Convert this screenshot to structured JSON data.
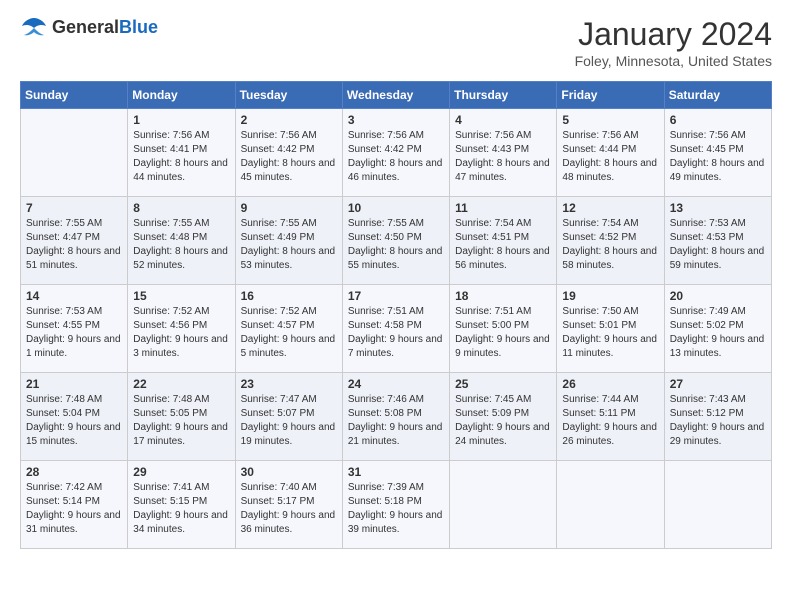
{
  "header": {
    "logo_general": "General",
    "logo_blue": "Blue",
    "month": "January 2024",
    "location": "Foley, Minnesota, United States"
  },
  "days_of_week": [
    "Sunday",
    "Monday",
    "Tuesday",
    "Wednesday",
    "Thursday",
    "Friday",
    "Saturday"
  ],
  "weeks": [
    [
      {
        "day": "",
        "sunrise": "",
        "sunset": "",
        "daylight": ""
      },
      {
        "day": "1",
        "sunrise": "Sunrise: 7:56 AM",
        "sunset": "Sunset: 4:41 PM",
        "daylight": "Daylight: 8 hours and 44 minutes."
      },
      {
        "day": "2",
        "sunrise": "Sunrise: 7:56 AM",
        "sunset": "Sunset: 4:42 PM",
        "daylight": "Daylight: 8 hours and 45 minutes."
      },
      {
        "day": "3",
        "sunrise": "Sunrise: 7:56 AM",
        "sunset": "Sunset: 4:42 PM",
        "daylight": "Daylight: 8 hours and 46 minutes."
      },
      {
        "day": "4",
        "sunrise": "Sunrise: 7:56 AM",
        "sunset": "Sunset: 4:43 PM",
        "daylight": "Daylight: 8 hours and 47 minutes."
      },
      {
        "day": "5",
        "sunrise": "Sunrise: 7:56 AM",
        "sunset": "Sunset: 4:44 PM",
        "daylight": "Daylight: 8 hours and 48 minutes."
      },
      {
        "day": "6",
        "sunrise": "Sunrise: 7:56 AM",
        "sunset": "Sunset: 4:45 PM",
        "daylight": "Daylight: 8 hours and 49 minutes."
      }
    ],
    [
      {
        "day": "7",
        "sunrise": "Sunrise: 7:55 AM",
        "sunset": "Sunset: 4:47 PM",
        "daylight": "Daylight: 8 hours and 51 minutes."
      },
      {
        "day": "8",
        "sunrise": "Sunrise: 7:55 AM",
        "sunset": "Sunset: 4:48 PM",
        "daylight": "Daylight: 8 hours and 52 minutes."
      },
      {
        "day": "9",
        "sunrise": "Sunrise: 7:55 AM",
        "sunset": "Sunset: 4:49 PM",
        "daylight": "Daylight: 8 hours and 53 minutes."
      },
      {
        "day": "10",
        "sunrise": "Sunrise: 7:55 AM",
        "sunset": "Sunset: 4:50 PM",
        "daylight": "Daylight: 8 hours and 55 minutes."
      },
      {
        "day": "11",
        "sunrise": "Sunrise: 7:54 AM",
        "sunset": "Sunset: 4:51 PM",
        "daylight": "Daylight: 8 hours and 56 minutes."
      },
      {
        "day": "12",
        "sunrise": "Sunrise: 7:54 AM",
        "sunset": "Sunset: 4:52 PM",
        "daylight": "Daylight: 8 hours and 58 minutes."
      },
      {
        "day": "13",
        "sunrise": "Sunrise: 7:53 AM",
        "sunset": "Sunset: 4:53 PM",
        "daylight": "Daylight: 8 hours and 59 minutes."
      }
    ],
    [
      {
        "day": "14",
        "sunrise": "Sunrise: 7:53 AM",
        "sunset": "Sunset: 4:55 PM",
        "daylight": "Daylight: 9 hours and 1 minute."
      },
      {
        "day": "15",
        "sunrise": "Sunrise: 7:52 AM",
        "sunset": "Sunset: 4:56 PM",
        "daylight": "Daylight: 9 hours and 3 minutes."
      },
      {
        "day": "16",
        "sunrise": "Sunrise: 7:52 AM",
        "sunset": "Sunset: 4:57 PM",
        "daylight": "Daylight: 9 hours and 5 minutes."
      },
      {
        "day": "17",
        "sunrise": "Sunrise: 7:51 AM",
        "sunset": "Sunset: 4:58 PM",
        "daylight": "Daylight: 9 hours and 7 minutes."
      },
      {
        "day": "18",
        "sunrise": "Sunrise: 7:51 AM",
        "sunset": "Sunset: 5:00 PM",
        "daylight": "Daylight: 9 hours and 9 minutes."
      },
      {
        "day": "19",
        "sunrise": "Sunrise: 7:50 AM",
        "sunset": "Sunset: 5:01 PM",
        "daylight": "Daylight: 9 hours and 11 minutes."
      },
      {
        "day": "20",
        "sunrise": "Sunrise: 7:49 AM",
        "sunset": "Sunset: 5:02 PM",
        "daylight": "Daylight: 9 hours and 13 minutes."
      }
    ],
    [
      {
        "day": "21",
        "sunrise": "Sunrise: 7:48 AM",
        "sunset": "Sunset: 5:04 PM",
        "daylight": "Daylight: 9 hours and 15 minutes."
      },
      {
        "day": "22",
        "sunrise": "Sunrise: 7:48 AM",
        "sunset": "Sunset: 5:05 PM",
        "daylight": "Daylight: 9 hours and 17 minutes."
      },
      {
        "day": "23",
        "sunrise": "Sunrise: 7:47 AM",
        "sunset": "Sunset: 5:07 PM",
        "daylight": "Daylight: 9 hours and 19 minutes."
      },
      {
        "day": "24",
        "sunrise": "Sunrise: 7:46 AM",
        "sunset": "Sunset: 5:08 PM",
        "daylight": "Daylight: 9 hours and 21 minutes."
      },
      {
        "day": "25",
        "sunrise": "Sunrise: 7:45 AM",
        "sunset": "Sunset: 5:09 PM",
        "daylight": "Daylight: 9 hours and 24 minutes."
      },
      {
        "day": "26",
        "sunrise": "Sunrise: 7:44 AM",
        "sunset": "Sunset: 5:11 PM",
        "daylight": "Daylight: 9 hours and 26 minutes."
      },
      {
        "day": "27",
        "sunrise": "Sunrise: 7:43 AM",
        "sunset": "Sunset: 5:12 PM",
        "daylight": "Daylight: 9 hours and 29 minutes."
      }
    ],
    [
      {
        "day": "28",
        "sunrise": "Sunrise: 7:42 AM",
        "sunset": "Sunset: 5:14 PM",
        "daylight": "Daylight: 9 hours and 31 minutes."
      },
      {
        "day": "29",
        "sunrise": "Sunrise: 7:41 AM",
        "sunset": "Sunset: 5:15 PM",
        "daylight": "Daylight: 9 hours and 34 minutes."
      },
      {
        "day": "30",
        "sunrise": "Sunrise: 7:40 AM",
        "sunset": "Sunset: 5:17 PM",
        "daylight": "Daylight: 9 hours and 36 minutes."
      },
      {
        "day": "31",
        "sunrise": "Sunrise: 7:39 AM",
        "sunset": "Sunset: 5:18 PM",
        "daylight": "Daylight: 9 hours and 39 minutes."
      },
      {
        "day": "",
        "sunrise": "",
        "sunset": "",
        "daylight": ""
      },
      {
        "day": "",
        "sunrise": "",
        "sunset": "",
        "daylight": ""
      },
      {
        "day": "",
        "sunrise": "",
        "sunset": "",
        "daylight": ""
      }
    ]
  ]
}
